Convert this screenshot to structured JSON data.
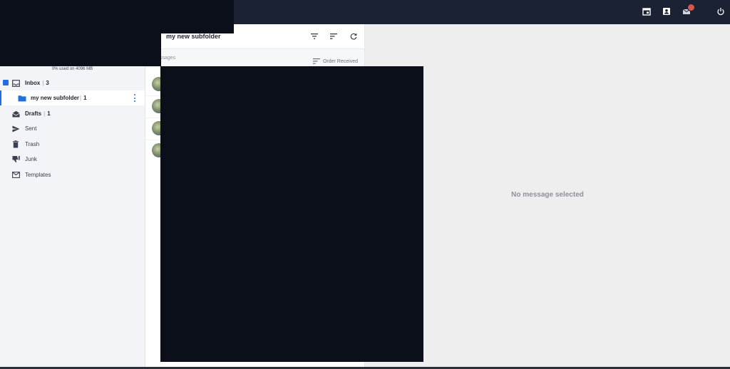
{
  "header": {
    "icons": [
      "calendar-icon",
      "contacts-icon",
      "mail-settings-icon",
      "power-icon"
    ]
  },
  "sidebar": {
    "quota_text": "0% used on 4096 MB",
    "folders": [
      {
        "label": "Inbox",
        "count": "3"
      },
      {
        "label": "my new subfolder",
        "count": "1"
      },
      {
        "label": "Drafts",
        "count": "1"
      },
      {
        "label": "Sent",
        "count": ""
      },
      {
        "label": "Trash",
        "count": ""
      },
      {
        "label": "Junk",
        "count": ""
      },
      {
        "label": "Templates",
        "count": ""
      }
    ]
  },
  "list": {
    "title": "my new subfolder",
    "message_count_label": "essages",
    "order_label": "Order Received"
  },
  "reading": {
    "empty_text": "No message selected"
  },
  "colors": {
    "topbar": "#1a2234",
    "accent": "#1f6fe0",
    "redaction": "#0b0f1a"
  }
}
